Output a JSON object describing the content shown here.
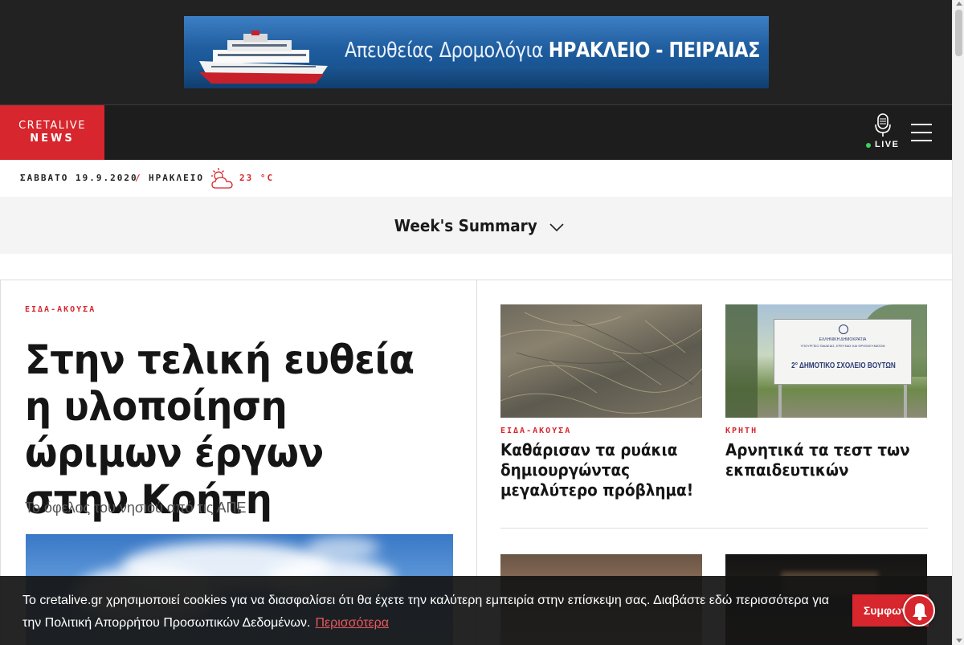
{
  "ad": {
    "text_regular": "Απευθείας Δρομολόγια ",
    "text_bold": "ΗΡΑΚΛΕΙΟ - ΠΕΙΡΑΙΑΣ"
  },
  "header": {
    "logo_line1": "CRETALIVE",
    "logo_line2": "NEWS",
    "live_label": "LIVE",
    "live_dot_color": "#3bd15c"
  },
  "datebar": {
    "date": "ΣΑΒΒΑΤΟ 19.9.2020",
    "separator": "/",
    "city": "ΗΡΑΚΛΕΙΟ",
    "weather_icon": "partly-cloudy-icon",
    "temperature": "23 °C"
  },
  "summary": {
    "title": "Week's Summary"
  },
  "lead": {
    "category": "ΕΙΔΑ-ΑΚΟΥΣΑ",
    "headline": "Στην τελική ευθεία η υλοποίηση ώριμων έργων στην Κρήτη",
    "subtitle": "Το όφελος του νησιού από τις ΑΠΕ"
  },
  "articles": [
    {
      "category": "ΕΙΔΑ-ΑΚΟΥΣΑ",
      "title": "Καθάρισαν τα ρυάκια δημιουργώντας μεγαλύτερο πρόβλημα!"
    },
    {
      "category": "ΚΡΗΤΗ",
      "title": "Αρνητικά τα τεστ των εκπαιδευτικών",
      "sign_lines": [
        "ΕΛΛΗΝΙΚΗ ΔΗΜΟΚΡΑΤΙΑ",
        "ΥΠΟΥΡΓΕΙΟ ΠΑΙΔΕΙΑΣ, ΕΡΕΥΝΑΣ ΚΑΙ ΘΡΗΣΚΕΥΜΑΤΩΝ",
        "2° ΔΗΜΟΤΙΚΟ ΣΧΟΛΕΙΟ ΒΟΥΤΩΝ"
      ]
    }
  ],
  "cookie": {
    "message": "Το cretalive.gr χρησιμοποιεί cookies για να διασφαλίσει ότι θα έχετε την καλύτερη εμπειρία στην επίσκεψη σας. Διαβάστε εδώ περισσότερα για την Πολιτική Απορρήτου Προσωπικών Δεδομένων.",
    "more_link": "Περισσότερα",
    "accept_label": "Συμφωνώ"
  },
  "colors": {
    "brand_red": "#d7262d",
    "dark": "#1d1d1d"
  }
}
